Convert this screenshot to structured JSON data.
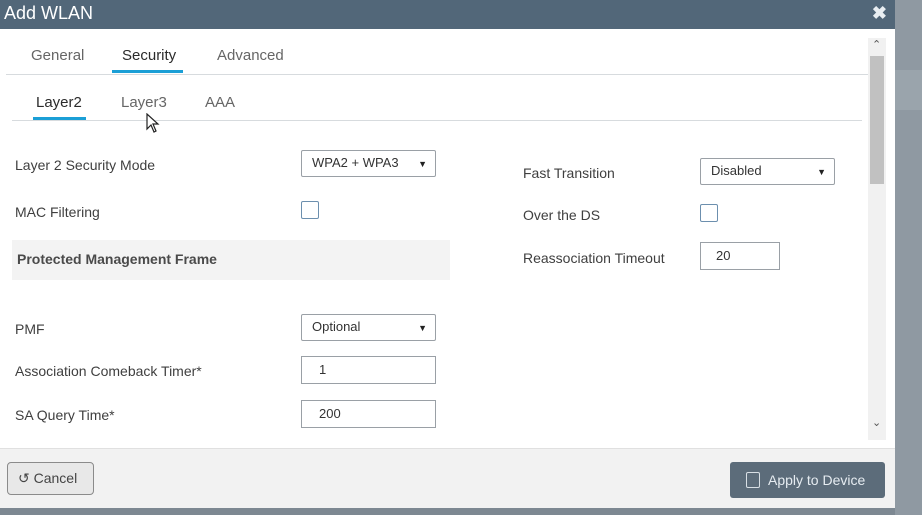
{
  "modal": {
    "title": "Add WLAN",
    "close_glyph": "✖"
  },
  "tabs_primary": [
    {
      "label": "General",
      "active": false
    },
    {
      "label": "Security",
      "active": true
    },
    {
      "label": "Advanced",
      "active": false
    }
  ],
  "tabs_secondary": [
    {
      "label": "Layer2",
      "active": true
    },
    {
      "label": "Layer3",
      "active": false
    },
    {
      "label": "AAA",
      "active": false
    }
  ],
  "left_form": {
    "security_mode": {
      "label": "Layer 2 Security Mode",
      "value": "WPA2 + WPA3"
    },
    "mac_filtering": {
      "label": "MAC Filtering",
      "checked": false
    },
    "pmf_section": {
      "label": "Protected Management Frame"
    },
    "pmf": {
      "label": "PMF",
      "value": "Optional"
    },
    "comeback_timer": {
      "label": "Association Comeback Timer*",
      "value": "1"
    },
    "sa_query_time": {
      "label": "SA Query Time*",
      "value": "200"
    }
  },
  "right_form": {
    "fast_transition": {
      "label": "Fast Transition",
      "value": "Disabled"
    },
    "over_the_ds": {
      "label": "Over the DS",
      "checked": false
    },
    "reassoc_timeout": {
      "label": "Reassociation Timeout",
      "value": "20"
    }
  },
  "footer": {
    "cancel_label": "Cancel",
    "cancel_icon": "↺",
    "apply_label": "Apply to Device"
  },
  "icons": {
    "caret": "▼",
    "scroll_up": "⌃",
    "scroll_down": "⌄"
  },
  "colors": {
    "titlebar": "#526779",
    "accent": "#1b9fd6",
    "apply_button": "#5c6c7a"
  }
}
